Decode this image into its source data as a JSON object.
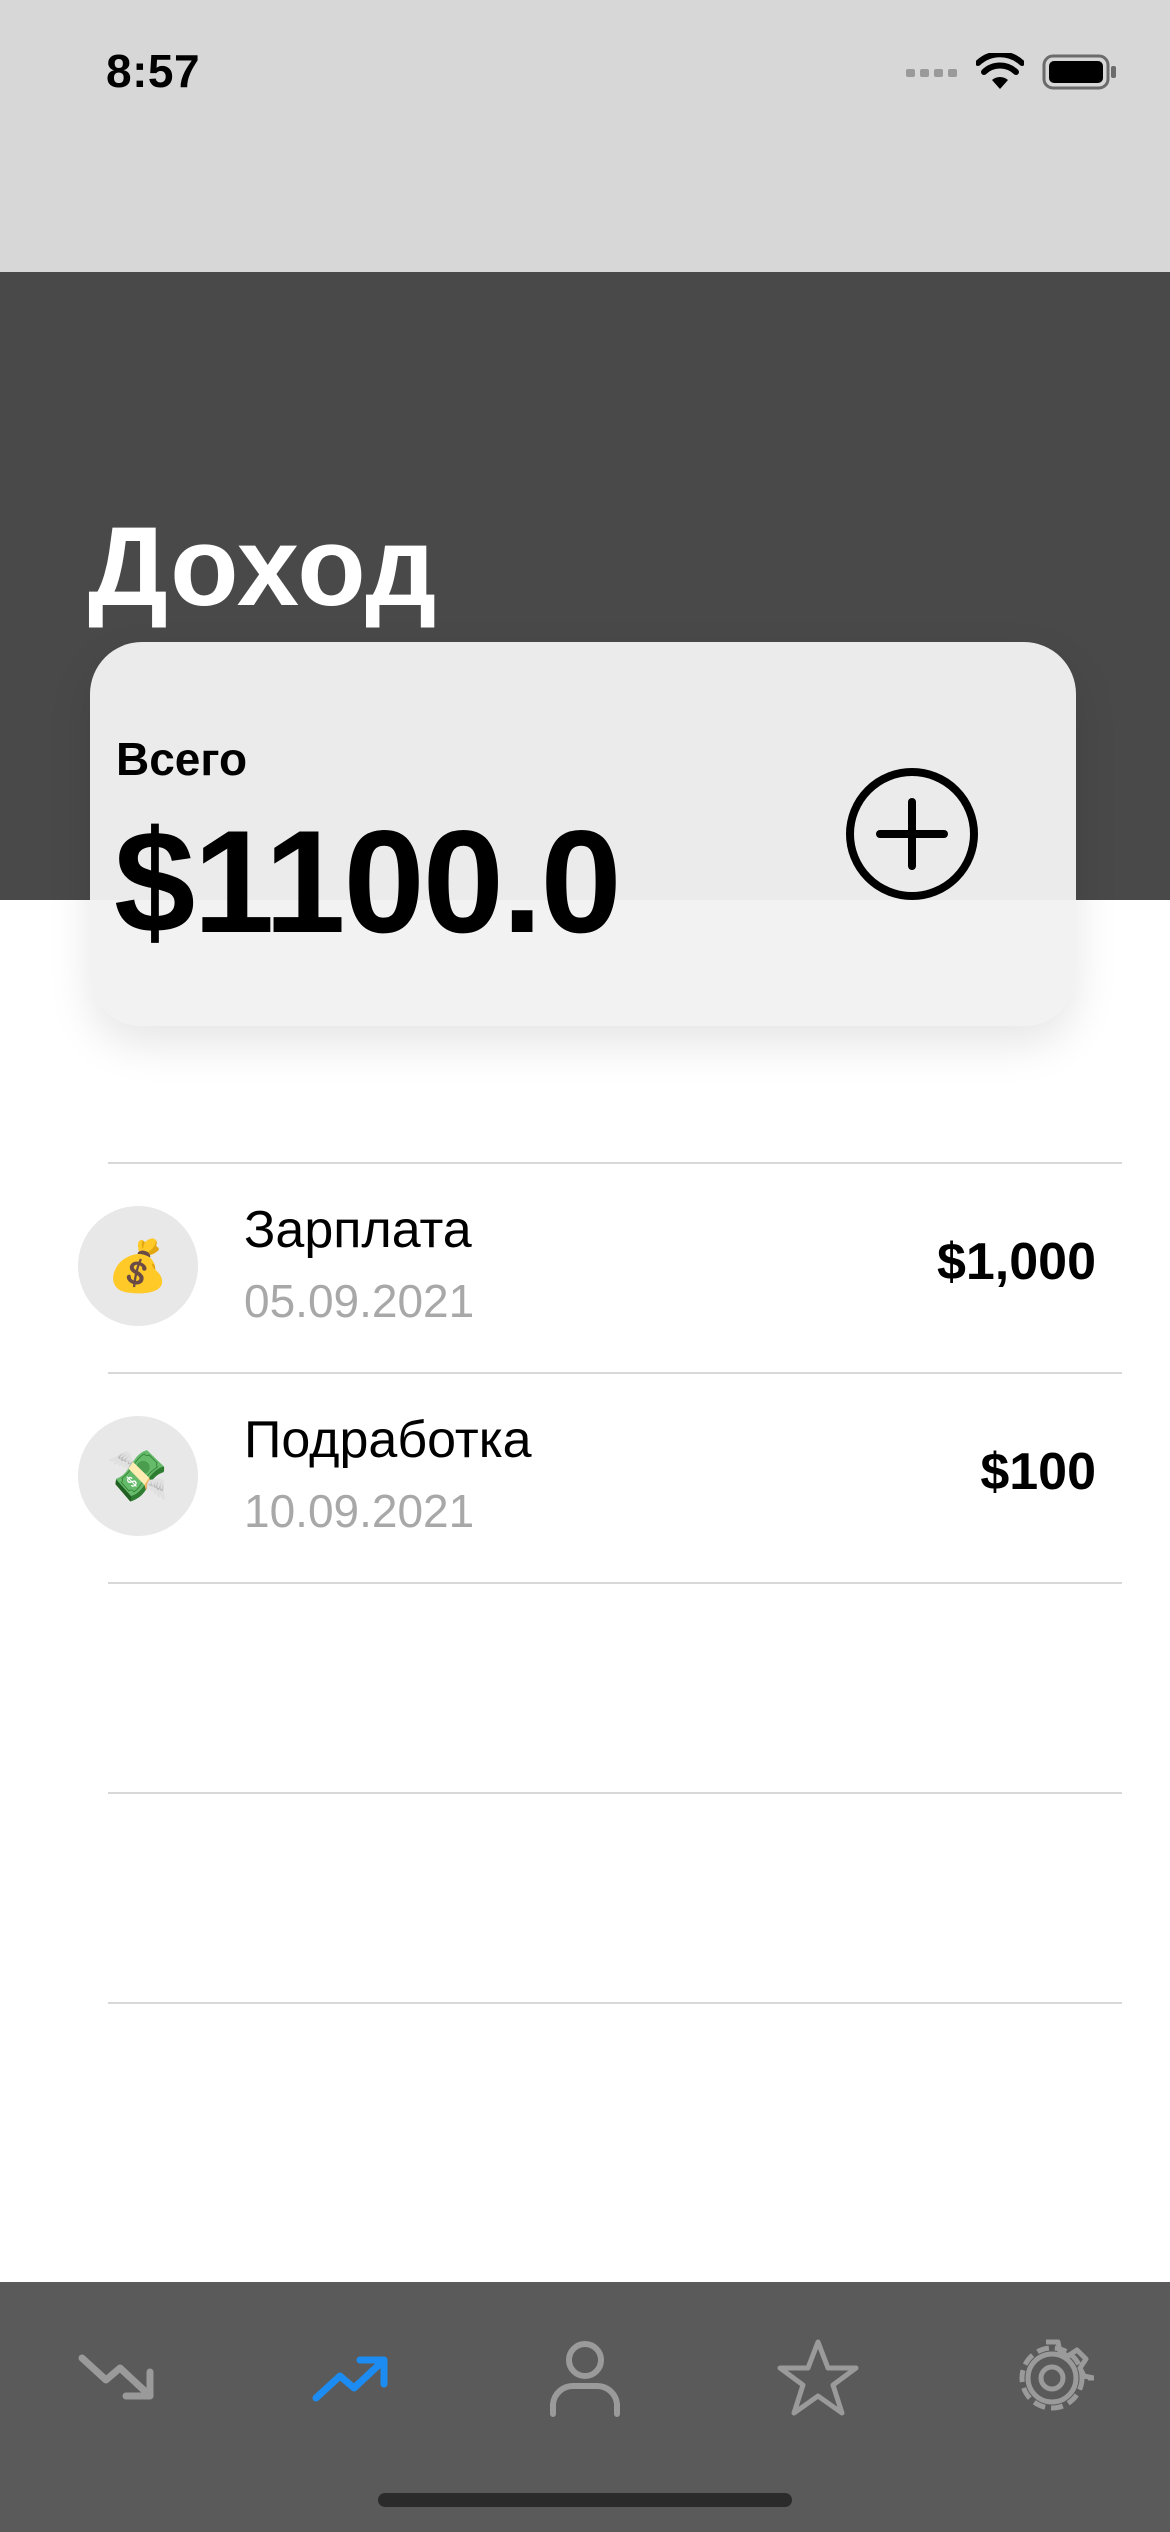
{
  "status_bar": {
    "time": "8:57",
    "battery": "battery-full-icon",
    "wifi": "wifi-icon",
    "signal": "cellular-signal-icon"
  },
  "header": {
    "title": "Доход"
  },
  "summary": {
    "label": "Всего",
    "amount": "$1100.0",
    "add_icon": "plus-circle-icon"
  },
  "transactions": [
    {
      "icon": "money-bag-icon",
      "emoji": "💰",
      "title": "Зарплата",
      "date": "05.09.2021",
      "amount": "$1,000"
    },
    {
      "icon": "flying-money-icon",
      "emoji": "💸",
      "title": "Подработка",
      "date": "10.09.2021",
      "amount": "$100"
    }
  ],
  "tab_bar": {
    "tabs": [
      {
        "name": "expenses",
        "icon": "trending-down-icon",
        "active": false
      },
      {
        "name": "income",
        "icon": "trending-up-icon",
        "active": true
      },
      {
        "name": "profile",
        "icon": "person-icon",
        "active": false
      },
      {
        "name": "favorites",
        "icon": "star-icon",
        "active": false
      },
      {
        "name": "settings",
        "icon": "gear-icon",
        "active": false
      }
    ],
    "active_color": "#1c8cf2",
    "inactive_color": "#9a9a9a"
  }
}
